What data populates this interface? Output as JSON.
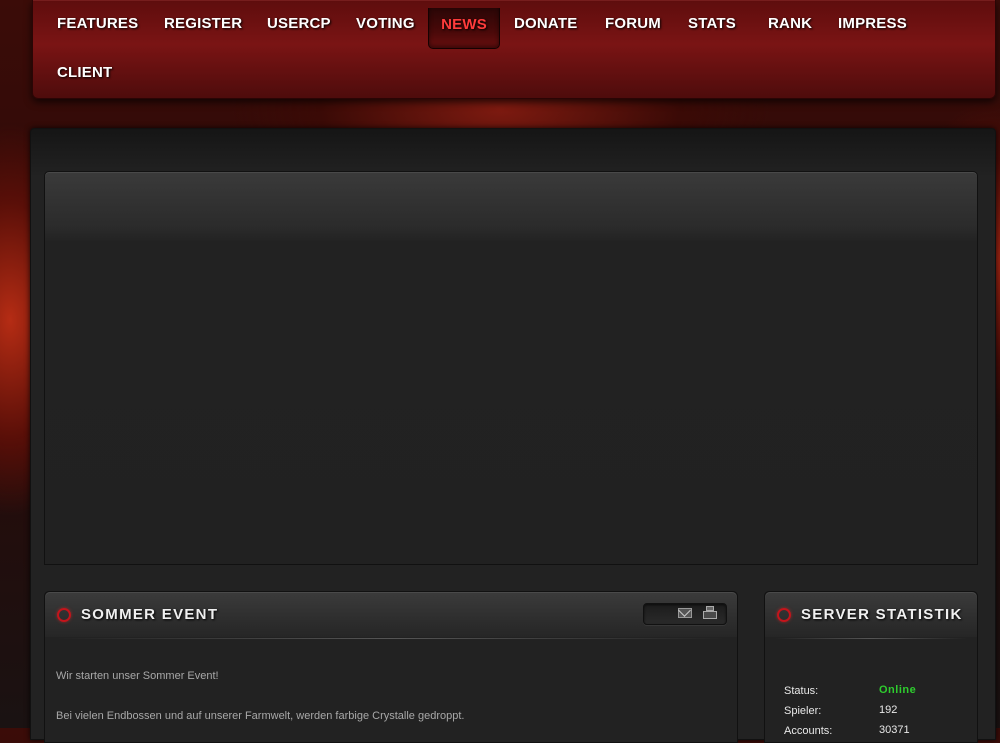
{
  "nav": {
    "items": [
      {
        "label": "FEATURES"
      },
      {
        "label": "REGISTER"
      },
      {
        "label": "USERCP"
      },
      {
        "label": "VOTING"
      },
      {
        "label": "NEWS"
      },
      {
        "label": "DONATE"
      },
      {
        "label": "FORUM"
      },
      {
        "label": "STATS"
      },
      {
        "label": "RANK"
      },
      {
        "label": "IMPRESS"
      },
      {
        "label": "CLIENT"
      }
    ],
    "active": "NEWS"
  },
  "news": {
    "title": "SOMMER EVENT",
    "paragraphs": [
      "Wir starten unser Sommer Event!",
      "Bei vielen Endbossen und auf unserer Farmwelt, werden farbige Crystalle gedroppt."
    ]
  },
  "server_stats": {
    "title": "SERVER STATISTIK",
    "rows": [
      {
        "label": "Status:",
        "value": "Online"
      },
      {
        "label": "Spieler:",
        "value": "192"
      },
      {
        "label": "Accounts:",
        "value": "30371"
      }
    ],
    "online_color": "#2ecc2e"
  },
  "colors": {
    "accent": "#c4141b",
    "nav_active": "#ff3b3b"
  }
}
